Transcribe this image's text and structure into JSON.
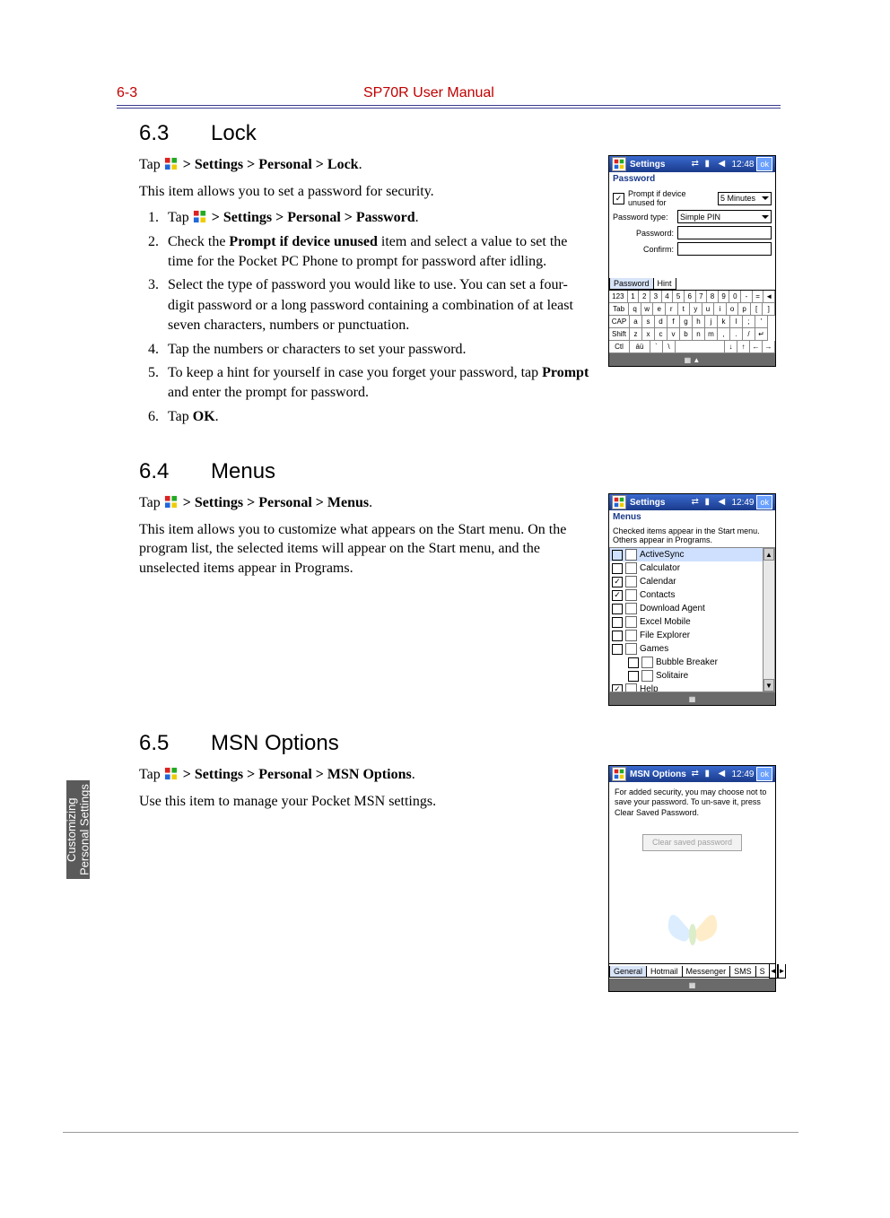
{
  "header": {
    "page_num": "6-3",
    "title": "SP70R User Manual"
  },
  "side_tab": "Customizing Personal Settings",
  "s63": {
    "heading_num": "6.3",
    "heading": "Lock",
    "path_prefix": "Tap ",
    "path": " > Settings > Personal > Lock",
    "intro": "This item allows you to set a password for security.",
    "li1a": "Tap ",
    "li1b": " > Settings > Personal > Password",
    "li2a": "Check the ",
    "li2b": "Prompt if device unused",
    "li2c": " item and select a value to set the time for the Pocket PC Phone to prompt for password after idling.",
    "li3": "Select the type of password you would like to use. You can set a four-digit password or a long password containing a combination of at least seven characters, numbers or punctuation.",
    "li4": "Tap the numbers or characters to set your password.",
    "li5a": "To keep a hint for yourself in case you forget your password, tap ",
    "li5b": "Prompt",
    "li5c": " and enter the prompt for password.",
    "li6a": "Tap ",
    "li6b": "OK",
    "li6c": "."
  },
  "s64": {
    "heading_num": "6.4",
    "heading": "Menus",
    "path_prefix": "Tap ",
    "path": " > Settings > Personal > Menus",
    "intro": "This item allows you to customize what appears on the Start menu. On the program list, the selected items will appear on the Start menu, and the unselected items appear in Programs."
  },
  "s65": {
    "heading_num": "6.5",
    "heading": "MSN Options",
    "path_prefix": "Tap ",
    "path": " > Settings > Personal > MSN Options",
    "intro": "Use this item to manage your Pocket MSN settings."
  },
  "shot1": {
    "title": "Settings",
    "time": "12:48",
    "ok": "ok",
    "sub": "Password",
    "prompt": "Prompt if device unused for",
    "prompt_val": "5 Minutes",
    "type_lbl": "Password type:",
    "type_val": "Simple PIN",
    "pwd_lbl": "Password:",
    "conf_lbl": "Confirm:",
    "tab1": "Password",
    "tab2": "Hint",
    "kbd_r0": [
      "123",
      "1",
      "2",
      "3",
      "4",
      "5",
      "6",
      "7",
      "8",
      "9",
      "0",
      "-",
      "=",
      "◄"
    ],
    "kbd_r1": [
      "Tab",
      "q",
      "w",
      "e",
      "r",
      "t",
      "y",
      "u",
      "i",
      "o",
      "p",
      "[",
      "]"
    ],
    "kbd_r2": [
      "CAP",
      "a",
      "s",
      "d",
      "f",
      "g",
      "h",
      "j",
      "k",
      "l",
      ";",
      "'"
    ],
    "kbd_r3": [
      "Shift",
      "z",
      "x",
      "c",
      "v",
      "b",
      "n",
      "m",
      ",",
      ".",
      "/",
      "↵"
    ],
    "kbd_r4": [
      "Ctl",
      "áü",
      "`",
      "\\",
      " ",
      "↓",
      "↑",
      "←",
      "→"
    ]
  },
  "shot2": {
    "title": "Settings",
    "time": "12:49",
    "ok": "ok",
    "sub": "Menus",
    "hint": "Checked items appear in the Start menu. Others appear in Programs.",
    "items": [
      {
        "c": false,
        "n": "ActiveSync",
        "sel": true
      },
      {
        "c": false,
        "n": "Calculator"
      },
      {
        "c": true,
        "n": "Calendar"
      },
      {
        "c": true,
        "n": "Contacts"
      },
      {
        "c": false,
        "n": "Download Agent"
      },
      {
        "c": false,
        "n": "Excel Mobile"
      },
      {
        "c": false,
        "n": "File Explorer"
      },
      {
        "c": false,
        "n": "Games"
      },
      {
        "c": false,
        "n": "Bubble Breaker",
        "indent": true
      },
      {
        "c": false,
        "n": "Solitaire",
        "indent": true
      },
      {
        "c": true,
        "n": "Help"
      }
    ]
  },
  "shot3": {
    "title": "MSN Options",
    "time": "12:49",
    "ok": "ok",
    "text": "For added security, you may choose not to save your password. To un-save it, press Clear Saved Password.",
    "btn": "Clear saved password",
    "tabs": [
      "General",
      "Hotmail",
      "Messenger",
      "SMS",
      "S"
    ]
  }
}
